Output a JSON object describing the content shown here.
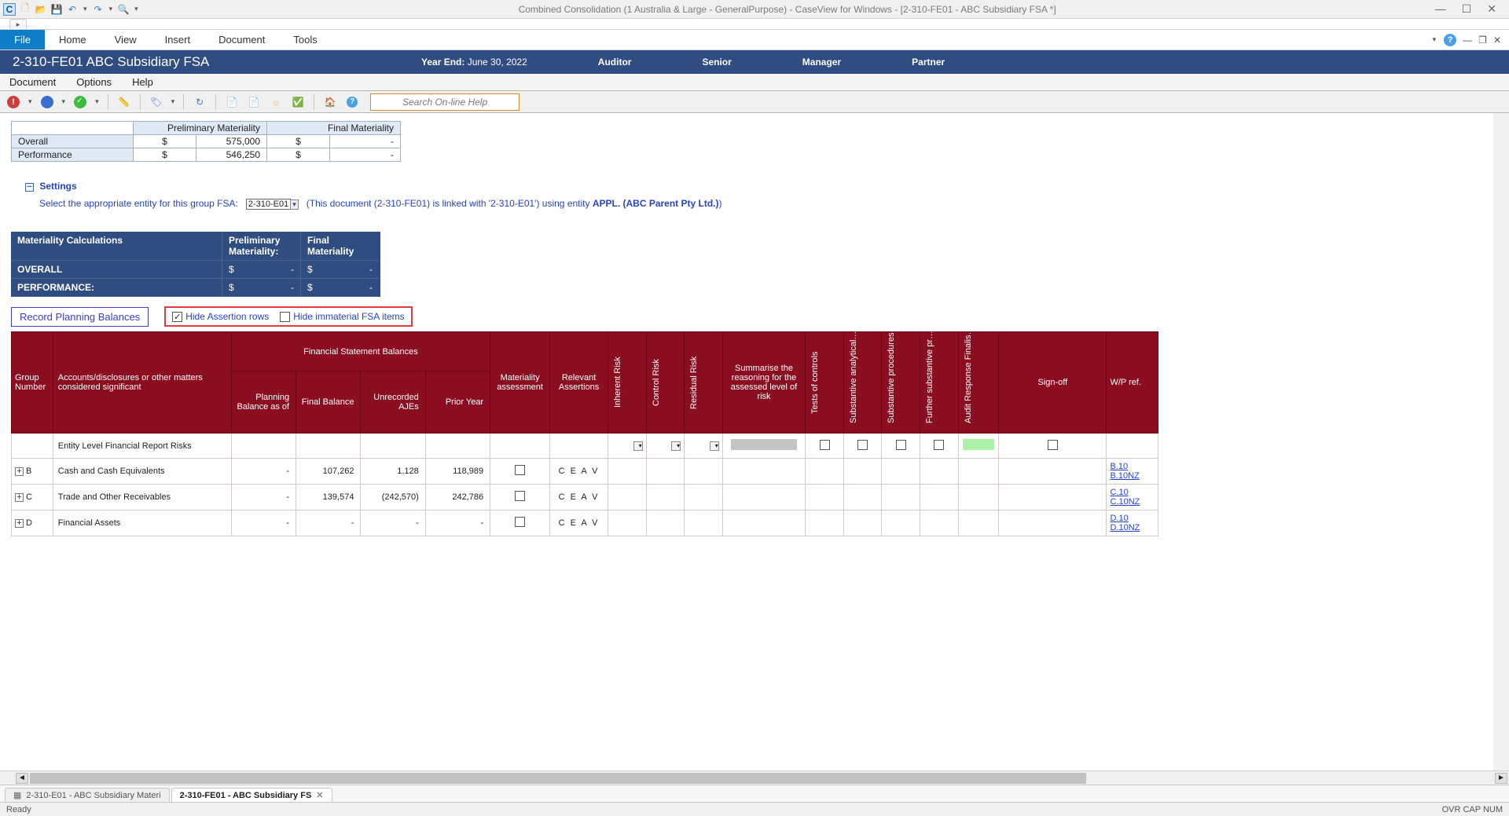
{
  "app_title": "Combined Consolidation (1 Australia & Large - GeneralPurpose) - CaseView for Windows - [2-310-FE01 - ABC Subsidiary FSA *]",
  "ribbon": {
    "file": "File",
    "items": [
      "Home",
      "View",
      "Insert",
      "Document",
      "Tools"
    ]
  },
  "doc_header": {
    "title": "2-310-FE01 ABC Subsidiary FSA",
    "year_end_label": "Year End:",
    "year_end": "June 30, 2022",
    "roles": [
      "Auditor",
      "Senior",
      "Manager",
      "Partner"
    ]
  },
  "submenu": [
    "Document",
    "Options",
    "Help"
  ],
  "search_placeholder": "Search On-line Help",
  "summary_table": {
    "col_prelim": "Preliminary Materiality",
    "col_final": "Final Materiality",
    "rows": [
      {
        "label": "Overall",
        "prelim_cur": "$",
        "prelim_val": "575,000",
        "final_cur": "$",
        "final_val": "-"
      },
      {
        "label": "Performance",
        "prelim_cur": "$",
        "prelim_val": "546,250",
        "final_cur": "$",
        "final_val": "-"
      }
    ]
  },
  "settings": {
    "label": "Settings",
    "prompt": "Select the appropriate entity for this group FSA:",
    "entity": "2-310-E01",
    "note_pre": "(This document (2-310-FE01) is linked with '2-310-E01') using entity ",
    "note_bold": "APPL. (ABC Parent Pty Ltd.)",
    "note_post": ")"
  },
  "matcalc": {
    "title": "Materiality Calculations",
    "col_prelim": "Preliminary Materiality:",
    "col_final": "Final Materiality",
    "rows": [
      {
        "label": "OVERALL",
        "pcur": "$",
        "pval": "-",
        "fcur": "$",
        "fval": "-"
      },
      {
        "label": "PERFORMANCE:",
        "pcur": "$",
        "pval": "-",
        "fcur": "$",
        "fval": "-"
      }
    ]
  },
  "controls": {
    "record_btn": "Record Planning Balances",
    "hide_assert": "Hide Assertion rows",
    "hide_immaterial": "Hide immaterial FSA items"
  },
  "fsa_headers": {
    "group": "Group Number",
    "accounts": "Accounts/disclosures or other matters considered significant",
    "fsb": "Financial Statement Balances",
    "planning": "Planning Balance as of",
    "final": "Final Balance",
    "unrec": "Unrecorded AJEs",
    "prior": "Prior Year",
    "mat": "Materiality assessment",
    "reva": "Relevant Assertions",
    "ir": "Inherent Risk",
    "cr": "Control Risk",
    "rr": "Residual Risk",
    "reason": "Summarise the reasoning for the assessed level of risk",
    "toc": "Tests of controls",
    "san": "Substantive analytical…",
    "sp": "Substantive procedures",
    "fsp": "Further substantive pr…",
    "arf": "Audit Response Finalis…",
    "signoff": "Sign-off",
    "wp": "W/P ref."
  },
  "fsa_rows": [
    {
      "grp": "",
      "acct": "Entity Level Financial Report Risks",
      "elr": true
    },
    {
      "grp": "B",
      "acct": "Cash and Cash Equivalents",
      "plan": "-",
      "final": "107,262",
      "unrec": "1,128",
      "prior": "118,989",
      "ceav": "C E A V",
      "wp": [
        "B.10",
        "B.10NZ"
      ]
    },
    {
      "grp": "C",
      "acct": "Trade and Other Receivables",
      "plan": "-",
      "final": "139,574",
      "unrec": "(242,570)",
      "prior": "242,786",
      "ceav": "C E A V",
      "wp": [
        "C.10",
        "C.10NZ"
      ]
    },
    {
      "grp": "D",
      "acct": "Financial Assets",
      "plan": "-",
      "final": "-",
      "unrec": "-",
      "prior": "-",
      "ceav": "C E A V",
      "wp": [
        "D.10",
        "D.10NZ"
      ]
    }
  ],
  "doctabs": [
    {
      "label": "2-310-E01 - ABC Subsidiary Materi",
      "active": false
    },
    {
      "label": "2-310-FE01 - ABC Subsidiary FS",
      "active": true
    }
  ],
  "status": {
    "left": "Ready",
    "right": "OVR  CAP  NUM"
  }
}
